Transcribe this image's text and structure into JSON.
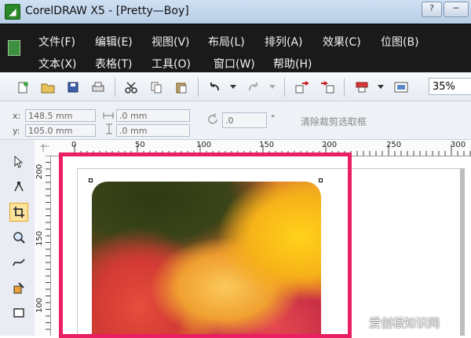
{
  "window": {
    "title": "CorelDRAW X5 - [Pretty—Boy]",
    "app_icon_glyph": "◢"
  },
  "window_buttons": {
    "help": "?",
    "minimize": "─"
  },
  "menu": {
    "row1": [
      "文件(F)",
      "编辑(E)",
      "视图(V)",
      "布局(L)",
      "排列(A)",
      "效果(C)",
      "位图(B)"
    ],
    "row2": [
      "文本(X)",
      "表格(T)",
      "工具(O)",
      "窗口(W)",
      "帮助(H)"
    ]
  },
  "toolbar": {
    "zoom": "35%"
  },
  "property_bar": {
    "x_label": "x:",
    "x_value": "148.5 mm",
    "y_label": "y:",
    "y_value": "105.0 mm",
    "width_value": ".0 mm",
    "height_value": ".0 mm",
    "angle_value": ".0",
    "degree_symbol": "°",
    "clear_crop": "清除裁剪选取框"
  },
  "ruler": {
    "h_ticks": [
      "0",
      "50",
      "100",
      "150",
      "200",
      "250",
      "300"
    ],
    "v_ticks": [
      "200",
      "150",
      "100"
    ]
  },
  "watermark": "爱创根知识网",
  "colors": {
    "highlight": "#ea1f63",
    "menubar": "#1a1a1a",
    "selected_tool": "#fde39c"
  }
}
